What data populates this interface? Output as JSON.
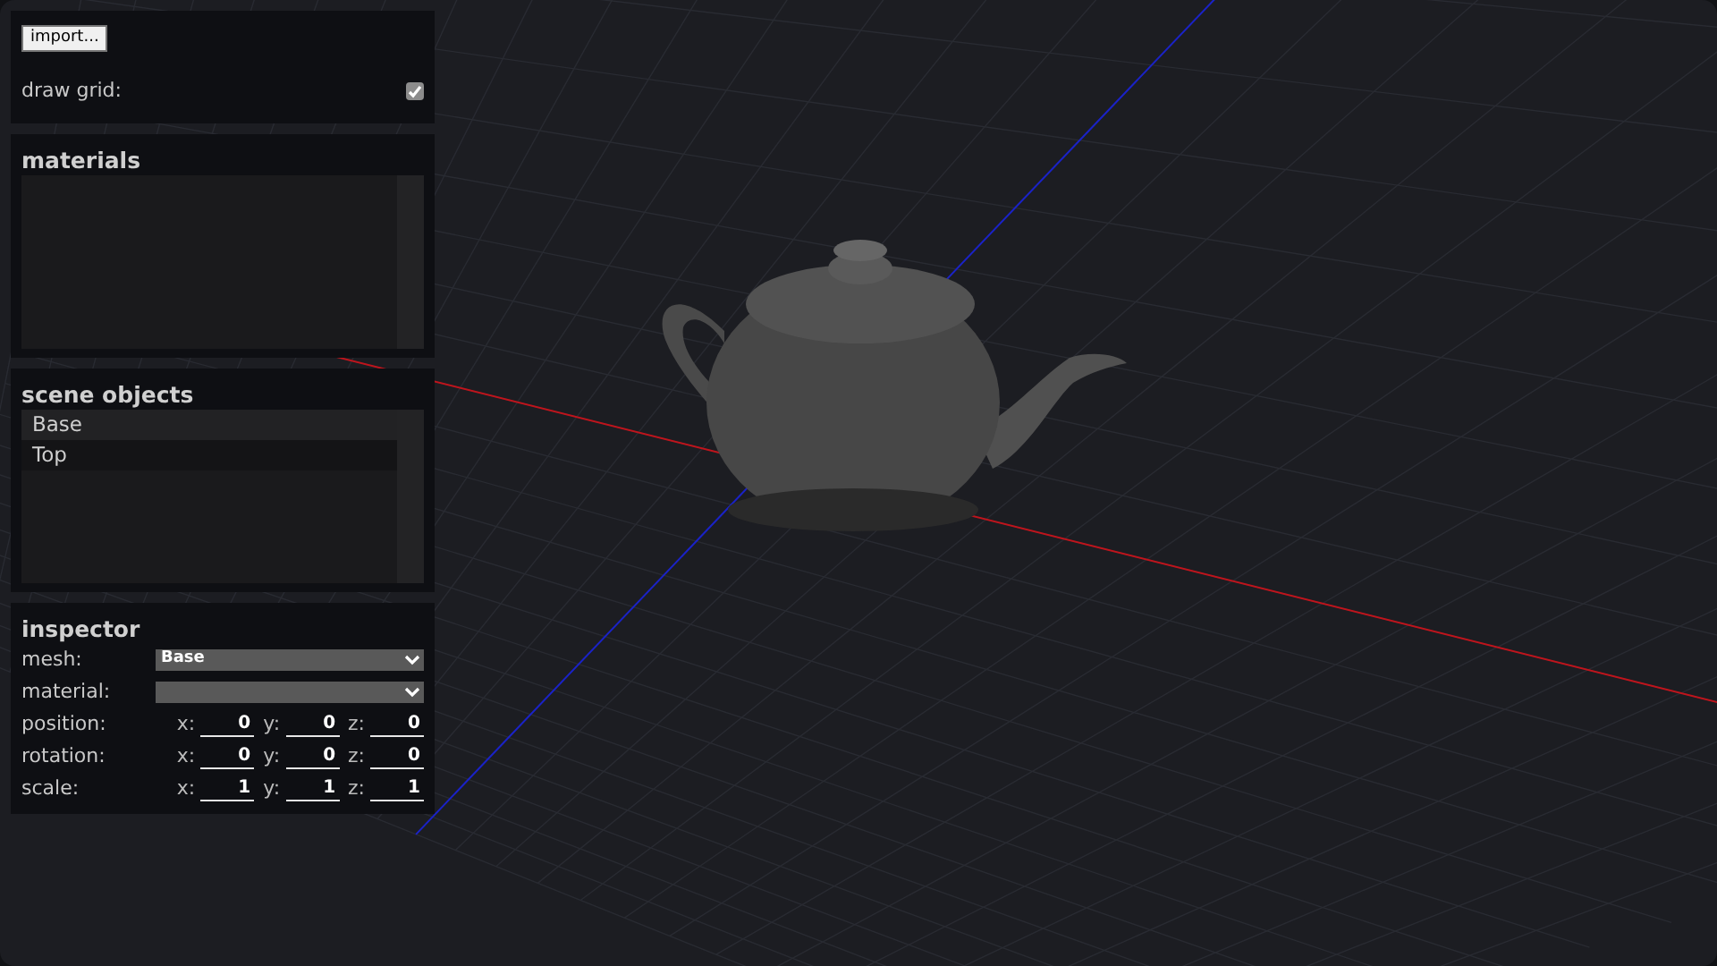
{
  "toolbar": {
    "import_button": "import...",
    "draw_grid": {
      "label": "draw grid:",
      "checked": true
    }
  },
  "materials": {
    "title": "materials"
  },
  "scene_objects": {
    "title": "scene objects",
    "items": [
      {
        "label": "Base",
        "selected": true
      },
      {
        "label": "Top",
        "selected": false
      }
    ]
  },
  "inspector": {
    "title": "inspector",
    "mesh": {
      "label": "mesh:",
      "value": "Base"
    },
    "material": {
      "label": "material:"
    },
    "transforms": [
      {
        "label": "position:",
        "fields": [
          {
            "axis": "x:",
            "value": "0"
          },
          {
            "axis": "y:",
            "value": "0"
          },
          {
            "axis": "z:",
            "value": "0"
          }
        ]
      },
      {
        "label": "rotation:",
        "fields": [
          {
            "axis": "x:",
            "value": "0"
          },
          {
            "axis": "y:",
            "value": "0"
          },
          {
            "axis": "z:",
            "value": "0"
          }
        ]
      },
      {
        "label": "scale:",
        "fields": [
          {
            "axis": "x:",
            "value": "1"
          },
          {
            "axis": "y:",
            "value": "1"
          },
          {
            "axis": "z:",
            "value": "1"
          }
        ]
      }
    ]
  }
}
